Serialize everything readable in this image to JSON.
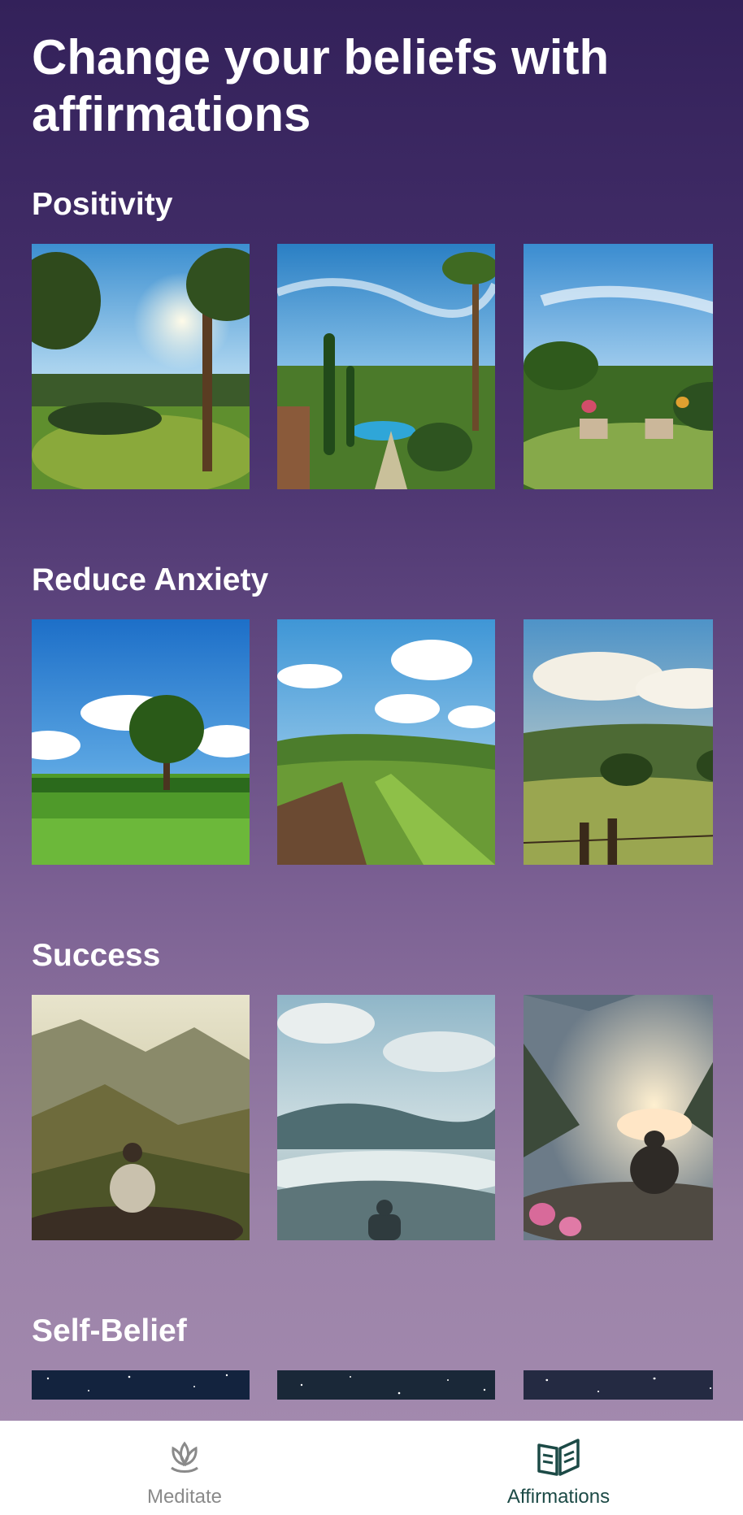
{
  "page_title": "Change your beliefs with affirmations",
  "sections": [
    {
      "title": "Positivity",
      "cards": [
        "sunny-garden",
        "poolside-garden",
        "patio-garden"
      ]
    },
    {
      "title": "Reduce Anxiety",
      "cards": [
        "lone-tree-meadow",
        "countryside-path",
        "valley-fence"
      ]
    },
    {
      "title": "Success",
      "cards": [
        "mountain-meditator",
        "misty-valley-figure",
        "sunset-meditator"
      ]
    },
    {
      "title": "Self-Belief",
      "cards": [
        "starry-sky-1",
        "starry-sky-2",
        "starry-sky-3"
      ]
    }
  ],
  "nav": {
    "meditate_label": "Meditate",
    "affirmations_label": "Affirmations",
    "meditate_icon": "lotus-icon",
    "affirmations_icon": "open-book-icon",
    "active": "Affirmations"
  },
  "colors": {
    "active_tab": "#1c4a46",
    "inactive_tab": "#8a8a8a"
  }
}
